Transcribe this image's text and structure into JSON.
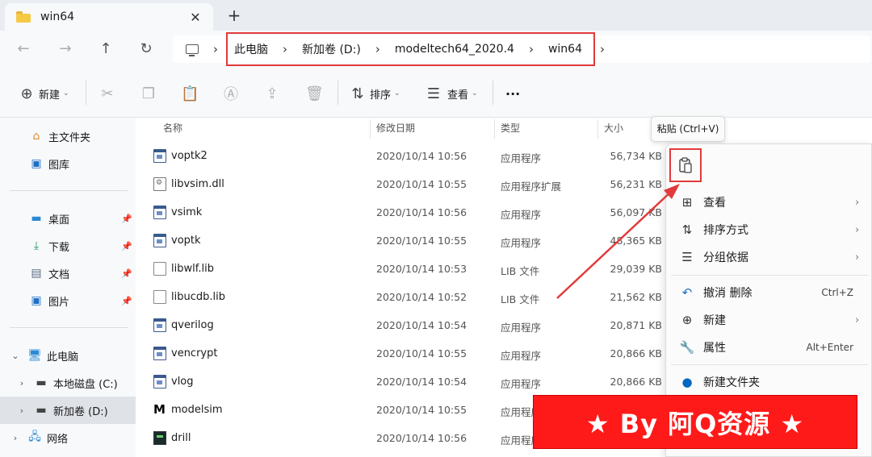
{
  "tab": {
    "title": "win64",
    "close_glyph": "✕",
    "new_tab_glyph": "+"
  },
  "nav": {
    "back_glyph": "←",
    "forward_glyph": "→",
    "up_glyph": "↑",
    "refresh_glyph": "↻",
    "sep_glyph": "›"
  },
  "breadcrumb": [
    "此电脑",
    "新加卷 (D:)",
    "modeltech64_2020.4",
    "win64"
  ],
  "toolbar": {
    "new_label": "新建",
    "sort_label": "排序",
    "view_label": "查看",
    "more_glyph": "···",
    "icons": [
      "new-icon",
      "cut-icon",
      "copy-icon",
      "paste-icon",
      "rename-icon",
      "share-icon",
      "delete-icon",
      "sort-icon",
      "view-icon",
      "more-icon"
    ]
  },
  "sidebar": {
    "items": [
      {
        "label": "主文件夹",
        "icon": "home-icon",
        "pinned": false
      },
      {
        "label": "图库",
        "icon": "gallery-icon",
        "pinned": false
      },
      {
        "label": "桌面",
        "icon": "desktop-icon",
        "pinned": true
      },
      {
        "label": "下载",
        "icon": "download-icon",
        "pinned": true
      },
      {
        "label": "文档",
        "icon": "document-icon",
        "pinned": true
      },
      {
        "label": "图片",
        "icon": "picture-icon",
        "pinned": true
      },
      {
        "label": "此电脑",
        "icon": "computer-icon",
        "expanded": true
      },
      {
        "label": "本地磁盘 (C:)",
        "icon": "drive-icon"
      },
      {
        "label": "新加卷 (D:)",
        "icon": "drive-icon",
        "selected": true
      },
      {
        "label": "网络",
        "icon": "network-icon"
      }
    ]
  },
  "columns": {
    "name": "名称",
    "date": "修改日期",
    "type": "类型",
    "size": "大小"
  },
  "files": [
    {
      "name": "voptk2",
      "date": "2020/10/14 10:56",
      "type": "应用程序",
      "size": "56,734 KB",
      "icon": "app"
    },
    {
      "name": "libvsim.dll",
      "date": "2020/10/14 10:55",
      "type": "应用程序扩展",
      "size": "56,231 KB",
      "icon": "dll"
    },
    {
      "name": "vsimk",
      "date": "2020/10/14 10:56",
      "type": "应用程序",
      "size": "56,097 KB",
      "icon": "app"
    },
    {
      "name": "voptk",
      "date": "2020/10/14 10:55",
      "type": "应用程序",
      "size": "48,365 KB",
      "icon": "app"
    },
    {
      "name": "libwlf.lib",
      "date": "2020/10/14 10:53",
      "type": "LIB 文件",
      "size": "29,039 KB",
      "icon": "lib"
    },
    {
      "name": "libucdb.lib",
      "date": "2020/10/14 10:52",
      "type": "LIB 文件",
      "size": "21,562 KB",
      "icon": "lib"
    },
    {
      "name": "qverilog",
      "date": "2020/10/14 10:54",
      "type": "应用程序",
      "size": "20,871 KB",
      "icon": "app"
    },
    {
      "name": "vencrypt",
      "date": "2020/10/14 10:55",
      "type": "应用程序",
      "size": "20,866 KB",
      "icon": "app"
    },
    {
      "name": "vlog",
      "date": "2020/10/14 10:54",
      "type": "应用程序",
      "size": "20,866 KB",
      "icon": "app"
    },
    {
      "name": "modelsim",
      "date": "2020/10/14 10:55",
      "type": "应用程序",
      "size": "",
      "icon": "modelsim"
    },
    {
      "name": "drill",
      "date": "2020/10/14 10:56",
      "type": "应用程序",
      "size": "",
      "icon": "drill"
    }
  ],
  "tooltip": "粘贴 (Ctrl+V)",
  "context_menu": {
    "items": [
      {
        "label": "查看",
        "icon": "grid-icon",
        "submenu": true
      },
      {
        "label": "排序方式",
        "icon": "sort-icon",
        "submenu": true
      },
      {
        "label": "分组依据",
        "icon": "group-icon",
        "submenu": true
      },
      {
        "label": "撤消 删除",
        "icon": "undo-icon",
        "shortcut": "Ctrl+Z"
      },
      {
        "label": "新建",
        "icon": "new-icon",
        "submenu": true
      },
      {
        "label": "属性",
        "icon": "properties-icon",
        "shortcut": "Alt+Enter"
      },
      {
        "label": "新建文件夹",
        "icon": "new-folder-icon"
      }
    ]
  },
  "watermark": "★ By 阿Q资源 ★",
  "colors": {
    "highlight_red": "#e23a3a",
    "accent_blue": "#0067c0",
    "watermark_red": "#ff1a1a"
  }
}
